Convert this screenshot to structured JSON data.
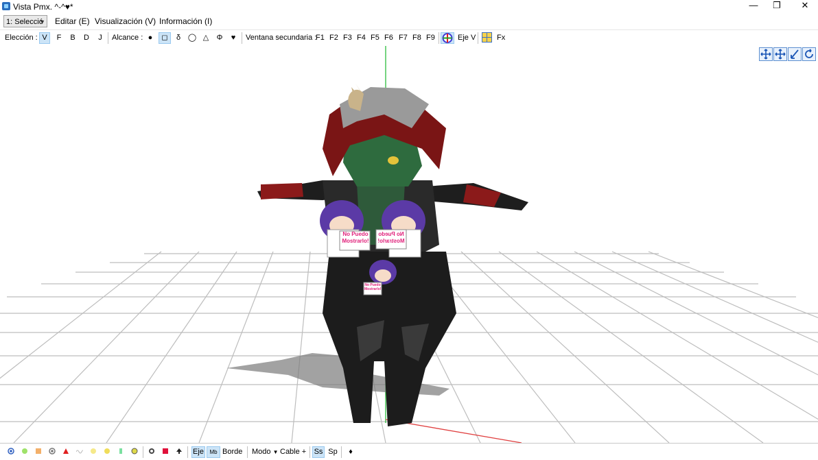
{
  "window": {
    "title": "Vista Pmx. ^-^♥*",
    "minimize_glyph": "—",
    "maximize_glyph": "❐",
    "close_glyph": "✕"
  },
  "menu": {
    "selector_value": "1: Selecció",
    "items": [
      "Editar (E)",
      "Visualización (V)",
      "Información (I)"
    ]
  },
  "toolbar": {
    "selection_label": "Elección :",
    "selection_modes": [
      "V",
      "F",
      "B",
      "D",
      "J"
    ],
    "range_label": "Alcance :",
    "range_shapes": [
      "●",
      "◻",
      "δ",
      "◯",
      "△",
      "Φ",
      "♥"
    ],
    "secondary_label": "Ventana secundaria :",
    "function_keys": [
      "F1",
      "F2",
      "F3",
      "F4",
      "F5",
      "F6",
      "F7",
      "F8",
      "F9"
    ],
    "axis_label": "Eje V",
    "fx_label": "Fx"
  },
  "viewport": {
    "sign_text": "No Puedo Mostrarlo!",
    "view_tools": [
      "move-view-icon",
      "pan-view-icon",
      "zoom-view-icon",
      "rotate-view-icon"
    ]
  },
  "bottombar": {
    "axis_button": "Eje",
    "mb_button": "Mb",
    "border_button": "Borde",
    "mode_button": "Modo",
    "cable_button": "Cable +",
    "ss_button": "Ss",
    "sp_button": "Sp"
  },
  "colors": {
    "accent": "#cce4f7",
    "grid": "#b9b9b9",
    "axis_y": "#2bbd3c",
    "axis_x": "#e04040"
  }
}
